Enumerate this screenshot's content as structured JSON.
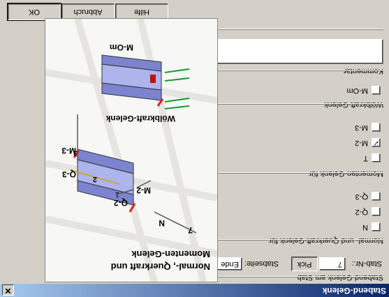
{
  "window": {
    "title": "Stabend-Gelenk",
    "close": "✕"
  },
  "stabend_group": {
    "label": "Stabend-Gelenk am Stab",
    "stab_label": "Stab-Nr.:",
    "stab_value": "7",
    "pick_label": "Pick",
    "stabseite_label": "Stabseite:",
    "stabseite_value": "Ende",
    "dropdown_arrow": "▼"
  },
  "normal_group": {
    "label": "Normal- und Querkraft-Gelenk für",
    "items": [
      {
        "label": "N",
        "checked": false
      },
      {
        "label": "Q-2",
        "checked": false
      },
      {
        "label": "Q-3",
        "checked": false
      }
    ]
  },
  "momenten_group": {
    "label": "Momenten-Gelenk für",
    "items": [
      {
        "label": "T",
        "checked": false
      },
      {
        "label": "M-2",
        "checked": true
      },
      {
        "label": "M-3",
        "checked": false
      }
    ]
  },
  "woelb_group": {
    "label": "Wölbkraft-Gelenk",
    "items": [
      {
        "label": "M-Om",
        "checked": false
      }
    ]
  },
  "kommentar": {
    "label": "Kommentar",
    "value": ""
  },
  "buttons": {
    "ok": "OK",
    "cancel": "Abbruch",
    "help": "Hilfe"
  },
  "preview": {
    "caption_line1": "Normal-, Querkraft und",
    "caption_line2": "Momenten-Gelenk",
    "woelb_caption": "Wölbkraft-Gelenk",
    "label_mom": "M-Om",
    "label_n": "N",
    "label_7": "7",
    "label_2": "2",
    "label_3": "3",
    "label_q2": "Q-2",
    "label_m2": "M-2",
    "label_q3": "Q-3",
    "label_m3": "M-3",
    "label_T": "T",
    "label_1": "1"
  },
  "colors": {
    "title_start": "#0a246a",
    "title_end": "#a6caf0",
    "member_blue": "#8a92d8",
    "hinge_red": "#e02020",
    "arrow_green": "#1a9a2a"
  }
}
